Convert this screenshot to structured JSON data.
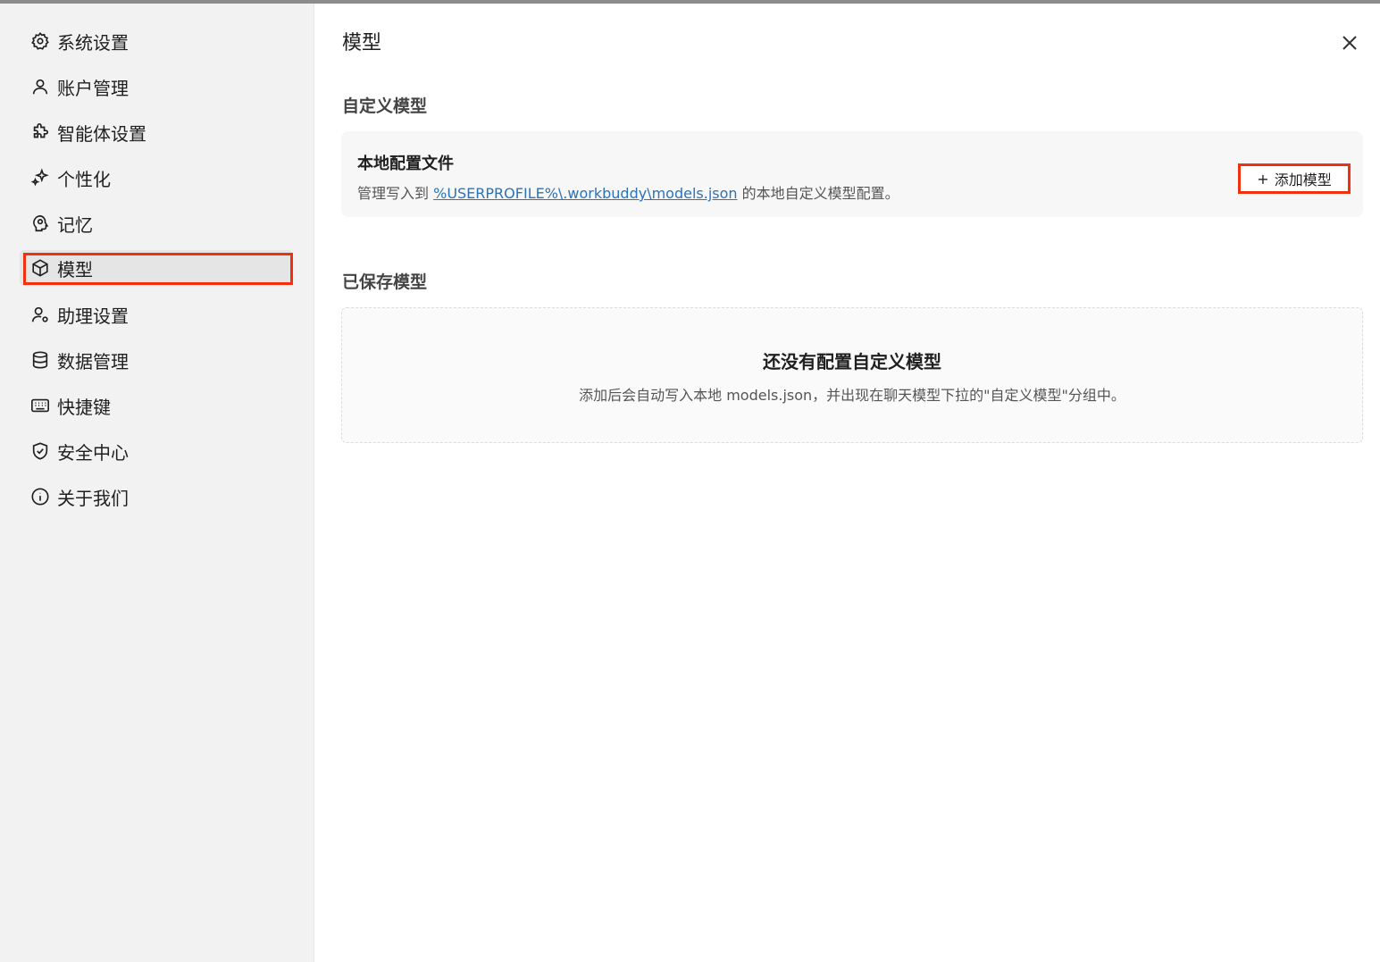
{
  "sidebar": {
    "items": [
      {
        "label": "系统设置",
        "icon": "gear-icon"
      },
      {
        "label": "账户管理",
        "icon": "user-icon"
      },
      {
        "label": "智能体设置",
        "icon": "puzzle-icon"
      },
      {
        "label": "个性化",
        "icon": "sparkle-icon"
      },
      {
        "label": "记忆",
        "icon": "brain-icon"
      },
      {
        "label": "模型",
        "icon": "cube-icon",
        "active": true
      },
      {
        "label": "助理设置",
        "icon": "user-gear-icon"
      },
      {
        "label": "数据管理",
        "icon": "database-icon"
      },
      {
        "label": "快捷键",
        "icon": "keyboard-icon"
      },
      {
        "label": "安全中心",
        "icon": "shield-icon"
      },
      {
        "label": "关于我们",
        "icon": "info-icon"
      }
    ]
  },
  "main": {
    "title": "模型",
    "custom_section": {
      "title": "自定义模型",
      "card": {
        "title": "本地配置文件",
        "desc_prefix": "管理写入到",
        "desc_link": "%USERPROFILE%\\.workbuddy\\models.json",
        "desc_suffix": "的本地自定义模型配置。",
        "add_button": "添加模型"
      }
    },
    "saved_section": {
      "title": "已保存模型",
      "empty_title": "还没有配置自定义模型",
      "empty_desc": "添加后会自动写入本地 models.json，并出现在聊天模型下拉的\"自定义模型\"分组中。"
    }
  },
  "colors": {
    "highlight": "#f0300f",
    "link": "#2a73b8",
    "sidebar_bg": "#f2f2f2"
  }
}
